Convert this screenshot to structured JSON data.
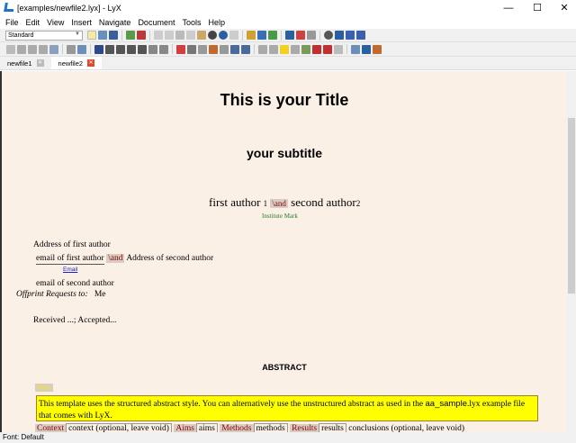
{
  "window": {
    "title": "[examples/newfile2.lyx] - LyX",
    "minimize": "—",
    "maximize": "☐",
    "close": "✕"
  },
  "menu": [
    "File",
    "Edit",
    "View",
    "Insert",
    "Navigate",
    "Document",
    "Tools",
    "Help"
  ],
  "toolbar": {
    "style_select": "Standard"
  },
  "tabs": [
    {
      "label": "newfile1",
      "active": false
    },
    {
      "label": "newfile2",
      "active": true
    }
  ],
  "doc": {
    "title": "This is your Title",
    "subtitle": "your subtitle",
    "author1": "first author",
    "mark1": "1",
    "and": "\\and",
    "author2": "second author",
    "mark2": "2",
    "institute_mark": "Institute Mark",
    "address1": "Address of first author",
    "email1": "email of first author",
    "email_label": "Email",
    "address2": "Address of second author",
    "email2": "email of second author",
    "offprint_label": "Offprint Requests to:",
    "offprint_value": "Me",
    "received": "Received ...; Accepted...",
    "abstract_heading": "ABSTRACT",
    "note_label": "Note",
    "note_text_1": "This template uses the structured abstract style. You can alternatively use the unstructured abstract as used in the ",
    "note_code": "aa_sample",
    "note_text_2": ".lyx example file that comes with LyX.",
    "context_label": "Context",
    "context_value": "context (optional, leave void)",
    "aims_label": "Aims",
    "aims_value": "aims",
    "methods_label": "Methods",
    "methods_value": "methods",
    "results_label": "Results",
    "results_value": "results",
    "conclusions": "conclusions (optional, leave void)"
  },
  "status": "Font: Default",
  "colors": {
    "doc_bg": "#faf0e6",
    "note_bg": "#ffff00",
    "inset_label": "#8b0000",
    "institute": "#2a7a2a",
    "tab_close_active": "#e04a2a"
  }
}
